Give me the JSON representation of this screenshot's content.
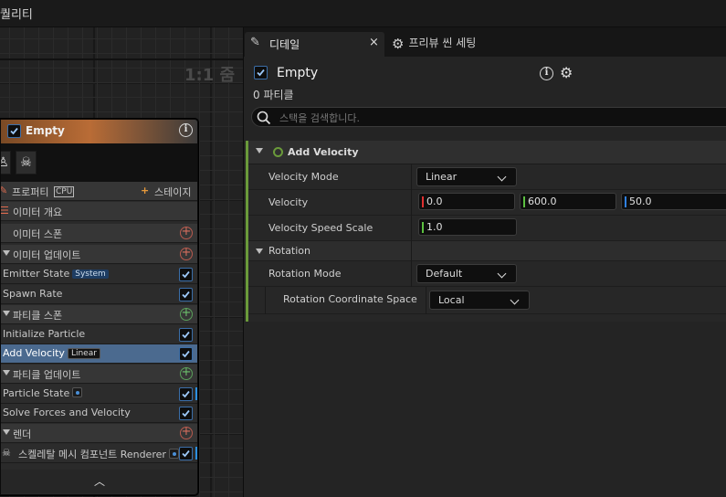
{
  "window": {
    "title_fragment": "퀄리티"
  },
  "graph": {
    "zoom_label": "1:1 줌"
  },
  "node": {
    "title": "Empty",
    "rows": [
      {
        "label": "프로퍼티",
        "badge": "CPU",
        "right": "스테이지"
      },
      {
        "label": "이미터 개요"
      },
      {
        "label": "이미터 스폰"
      },
      {
        "label": "이미터 업데이트"
      },
      {
        "label": "Emitter State",
        "badge": "System"
      },
      {
        "label": "Spawn Rate"
      },
      {
        "label": "파티클 스폰"
      },
      {
        "label": "Initialize Particle"
      },
      {
        "label": "Add Velocity",
        "badge": "Linear"
      },
      {
        "label": "파티클 업데이트"
      },
      {
        "label": "Particle State"
      },
      {
        "label": "Solve Forces and Velocity"
      },
      {
        "label": "렌더"
      },
      {
        "label": "스켈레탈 메시 컴포넌트 Renderer"
      }
    ]
  },
  "tabs": [
    {
      "label": "디테일",
      "close": "×"
    },
    {
      "label": "프리뷰 씬 세팅"
    }
  ],
  "details": {
    "object_name": "Empty",
    "particle_count": "0 파티클",
    "search_placeholder": "스택을 검색합니다.",
    "section_title": "Add Velocity",
    "properties": {
      "velocity_mode_label": "Velocity Mode",
      "velocity_mode_value": "Linear",
      "velocity_label": "Velocity",
      "velocity_x": "0.0",
      "velocity_y": "600.0",
      "velocity_z": "50.0",
      "speed_scale_label": "Velocity Speed Scale",
      "speed_scale_value": "1.0",
      "rotation_label": "Rotation",
      "rotation_mode_label": "Rotation Mode",
      "rotation_mode_value": "Default",
      "rotation_space_label": "Rotation Coordinate Space",
      "rotation_space_value": "Local"
    }
  },
  "colors": {
    "accent_blue": "#2b8fe0",
    "section_green": "#6a9a3a",
    "header_orange": "#b96c36",
    "x_axis": "#e03030",
    "y_axis": "#5cc040",
    "z_axis": "#3080e0"
  }
}
